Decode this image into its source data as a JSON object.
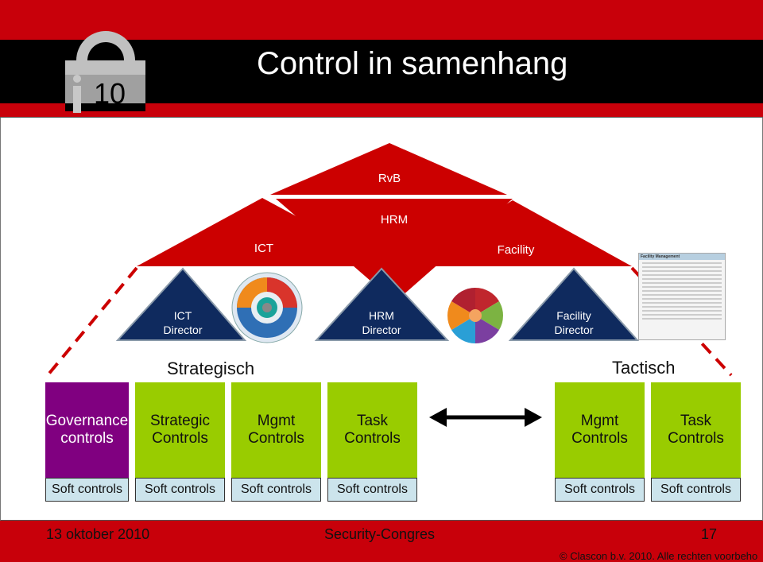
{
  "header": {
    "title": "Control in samenhang",
    "logo_text": "i10"
  },
  "pyramid": {
    "top": "RvB",
    "middle": "HRM",
    "left": "ICT",
    "right": "Facility",
    "directors": [
      "ICT Director",
      "HRM Director",
      "Facility Director"
    ]
  },
  "facility_table": {
    "title": "Facility Management"
  },
  "levels": {
    "left": "Strategisch",
    "right": "Tactisch"
  },
  "controls": [
    {
      "line1": "Governance",
      "line2": "controls",
      "soft": "Soft controls"
    },
    {
      "line1": "Strategic",
      "line2": "Controls",
      "soft": "Soft controls"
    },
    {
      "line1": "Mgmt",
      "line2": "Controls",
      "soft": "Soft controls"
    },
    {
      "line1": "Task",
      "line2": "Controls",
      "soft": "Soft controls"
    },
    {
      "line1": "Mgmt",
      "line2": "Controls",
      "soft": "Soft controls"
    },
    {
      "line1": "Task",
      "line2": "Controls",
      "soft": "Soft controls"
    }
  ],
  "footer": {
    "date": "13 oktober 2010",
    "event": "Security-Congres",
    "page": "17",
    "copyright": "© Clascon b.v. 2010. Alle rechten voorbeho"
  },
  "colors": {
    "red": "#c8000a",
    "navy": "#0f2a5e",
    "green": "#99cc00",
    "purple": "#800080",
    "soft": "#cce4ec"
  }
}
